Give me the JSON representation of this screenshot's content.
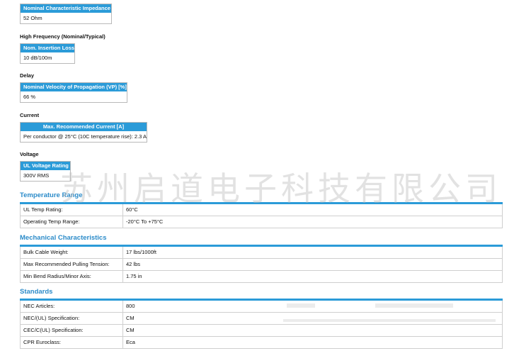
{
  "impedance": {
    "header": "Nominal Characteristic Impedance",
    "value": "52 Ohm"
  },
  "high_frequency": {
    "title": "High Frequency (Nominal/Typical)",
    "header": "Nom. Insertion Loss",
    "value": "10 dB/100m"
  },
  "delay": {
    "title": "Delay",
    "header": "Nominal Velocity of Propagation (VP) [%]",
    "value": "66 %"
  },
  "current": {
    "title": "Current",
    "header": "Max. Recommended Current [A]",
    "value": "Per conductor @ 25°C (10C temperature rise): 2.3 A"
  },
  "voltage": {
    "title": "Voltage",
    "header": "UL Voltage Rating",
    "value": "300V RMS"
  },
  "watermark": "苏州启道电子科技有限公司",
  "temperature": {
    "title": "Temperature Range",
    "rows": [
      {
        "label": "UL Temp Rating:",
        "value": "60°C"
      },
      {
        "label": "Operating Temp Range:",
        "value": "-20°C To +75°C"
      }
    ]
  },
  "mechanical": {
    "title": "Mechanical Characteristics",
    "rows": [
      {
        "label": "Bulk Cable Weight:",
        "value": "17 lbs/1000ft"
      },
      {
        "label": "Max Recommended Pulling Tension:",
        "value": "42 lbs"
      },
      {
        "label": "Min Bend Radius/Minor Axis:",
        "value": "1.75 in"
      }
    ]
  },
  "standards": {
    "title": "Standards",
    "rows": [
      {
        "label": "NEC Articles:",
        "value": "800"
      },
      {
        "label": "NEC/(UL) Specification:",
        "value": "CM"
      },
      {
        "label": "CEC/C(UL) Specification:",
        "value": "CM"
      },
      {
        "label": "CPR Euroclass:",
        "value": "Eca"
      }
    ]
  }
}
